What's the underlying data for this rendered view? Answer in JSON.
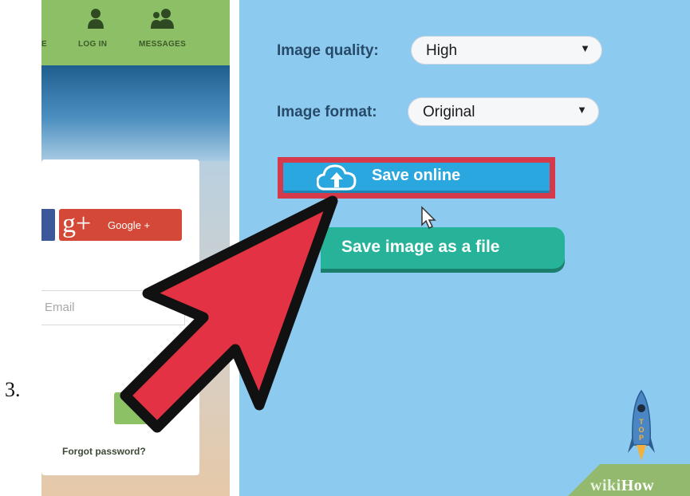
{
  "step": {
    "number": "3."
  },
  "website": {
    "nav": [
      {
        "label": "E",
        "icon": "partial-icon"
      },
      {
        "label": "LOG IN",
        "icon": "user-icon"
      },
      {
        "label": "MESSAGES",
        "icon": "users-icon"
      }
    ],
    "social": {
      "google_label": "Google +",
      "google_mark": "g+"
    },
    "email_placeholder": "Email",
    "forgot_password": "Forgot password?"
  },
  "settings": {
    "quality_label": "Image quality:",
    "quality_value": "High",
    "format_label": "Image format:",
    "format_value": "Original",
    "select_arrow": "▼"
  },
  "actions": {
    "save_online": "Save online",
    "save_file": "Save image as a file"
  },
  "branding": {
    "rocket_text": "TOP",
    "wiki": "wiki",
    "how": "How"
  },
  "colors": {
    "accent_highlight": "#d63a4a",
    "save_online_bg": "#2aa7de",
    "save_file_bg": "#27b39a",
    "panel_bg": "#8dcaf0"
  }
}
